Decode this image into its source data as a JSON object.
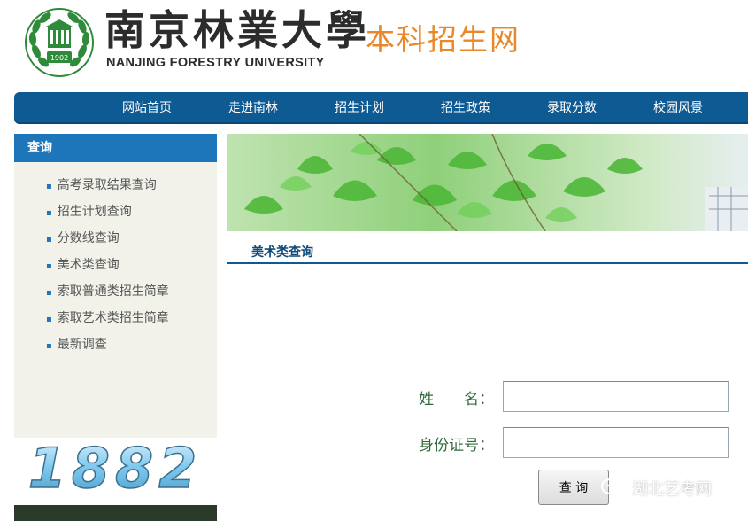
{
  "header": {
    "university_cn": "南京林業大學",
    "university_en": "NANJING FORESTRY UNIVERSITY",
    "emblem_year": "1902",
    "site_title": "本科招生网"
  },
  "nav": {
    "items": [
      "网站首页",
      "走进南林",
      "招生计划",
      "招生政策",
      "录取分数",
      "校园风景"
    ]
  },
  "sidebar": {
    "title": "查询",
    "items": [
      "高考录取结果查询",
      "招生计划查询",
      "分数线查询",
      "美术类查询",
      "索取普通类招生简章",
      "索取艺术类招生简章",
      "最新调查"
    ],
    "year_banner": "1882"
  },
  "main": {
    "section_title": "美术类查询",
    "form": {
      "name_label": "姓　　名：",
      "name_value": "",
      "id_label": "身份证号：",
      "id_value": "",
      "submit_label": "查 询"
    }
  },
  "watermark": {
    "text": "湖北艺考网"
  },
  "colors": {
    "nav_bg": "#0e5a93",
    "sidebar_header": "#1c76b9",
    "site_title": "#e8882a",
    "form_label": "#2f6a3a"
  }
}
